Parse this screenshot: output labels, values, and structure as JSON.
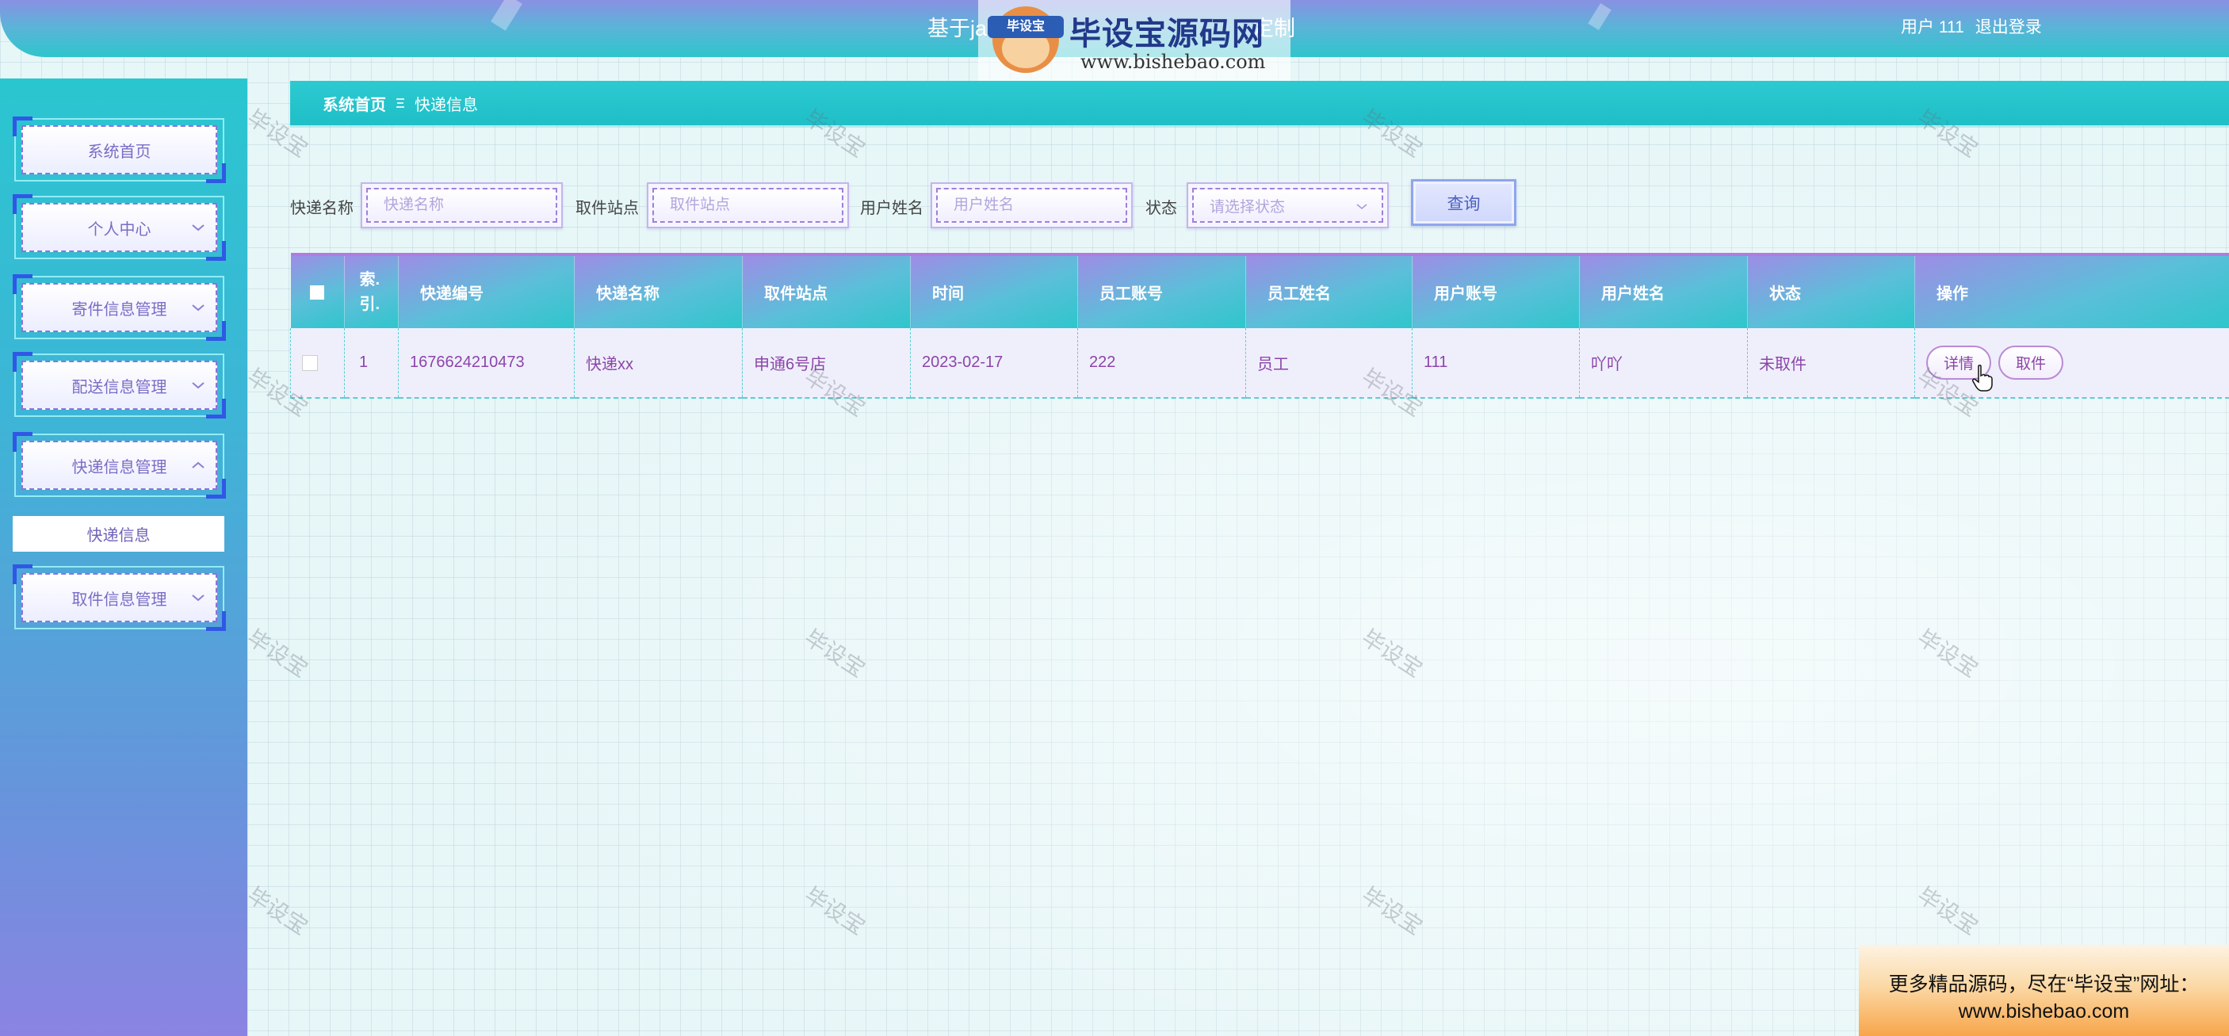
{
  "header": {
    "title_left": "基于ja",
    "title_right": "定制",
    "user_label": "用户 111",
    "logout": "退出登录"
  },
  "logo_watermark": {
    "badge": "毕设宝",
    "name": "毕设宝源码网",
    "url": "www.bishebao.com"
  },
  "sidebar": {
    "items": [
      {
        "label": "系统首页",
        "icon": "none"
      },
      {
        "label": "个人中心",
        "icon": "chevron-down-icon"
      },
      {
        "label": "寄件信息管理",
        "icon": "chevron-down-icon"
      },
      {
        "label": "配送信息管理",
        "icon": "chevron-down-icon"
      },
      {
        "label": "快递信息管理",
        "icon": "chevron-up-icon",
        "expanded": true,
        "children": [
          {
            "label": "快递信息",
            "active": true
          }
        ]
      },
      {
        "label": "取件信息管理",
        "icon": "chevron-down-icon"
      }
    ]
  },
  "breadcrumb": {
    "home": "系统首页",
    "separator_icon": "menu-lines-icon",
    "current": "快递信息"
  },
  "search": {
    "fields": [
      {
        "label": "快递名称",
        "placeholder": "快递名称"
      },
      {
        "label": "取件站点",
        "placeholder": "取件站点"
      },
      {
        "label": "用户姓名",
        "placeholder": "用户姓名"
      }
    ],
    "status": {
      "label": "状态",
      "placeholder": "请选择状态"
    },
    "query_button": "查询"
  },
  "table": {
    "columns": [
      "索.引.",
      "快递编号",
      "快递名称",
      "取件站点",
      "时间",
      "员工账号",
      "员工姓名",
      "用户账号",
      "用户姓名",
      "状态",
      "操作"
    ],
    "rows": [
      {
        "index": "1",
        "number": "1676624210473",
        "name": "快递xx",
        "station": "申通6号店",
        "time": "2023-02-17",
        "staff_account": "222",
        "staff_name": "员工",
        "user_account": "111",
        "user_name": "吖吖",
        "status": "未取件",
        "actions": [
          "详情",
          "取件"
        ]
      }
    ]
  },
  "watermark": {
    "text": "毕设宝"
  },
  "promo": {
    "line1": "更多精品源码，尽在“毕设宝”网址：",
    "line2": "www.bishebao.com"
  },
  "colors": {
    "header": "#2fc5cc",
    "sidebar_top": "#2ac6d0",
    "sidebar_bottom": "#8b83e2",
    "breadcrumb": "#1fbfc8",
    "table_text": "#8b45a9",
    "table_header_border": "#b27be0"
  }
}
